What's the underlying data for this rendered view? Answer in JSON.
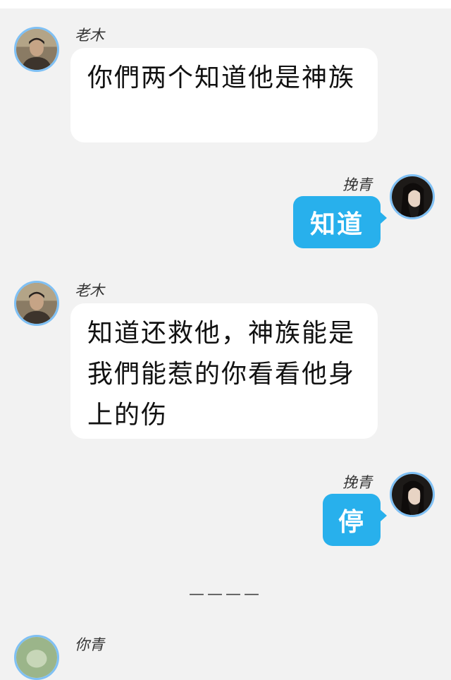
{
  "messages": [
    {
      "side": "left",
      "sender": "老木",
      "text": "你們两个知道他是神族",
      "avatar_icon": "male-portrait-avatar"
    },
    {
      "side": "right",
      "sender": "挽青",
      "text": "知道",
      "avatar_icon": "female-portrait-avatar"
    },
    {
      "side": "left",
      "sender": "老木",
      "text": "知道还救他，神族能是我們能惹的你看看他身上的伤",
      "avatar_icon": "male-portrait-avatar"
    },
    {
      "side": "right",
      "sender": "挽青",
      "text": "停",
      "avatar_icon": "female-portrait-avatar"
    }
  ],
  "divider": "————",
  "partial_next": {
    "sender": "你青",
    "avatar_icon": "green-portrait-avatar"
  },
  "colors": {
    "background": "#f2f2f2",
    "left_bubble": "#ffffff",
    "right_bubble": "#28b0ec",
    "avatar_ring": "#7fc0f4"
  }
}
